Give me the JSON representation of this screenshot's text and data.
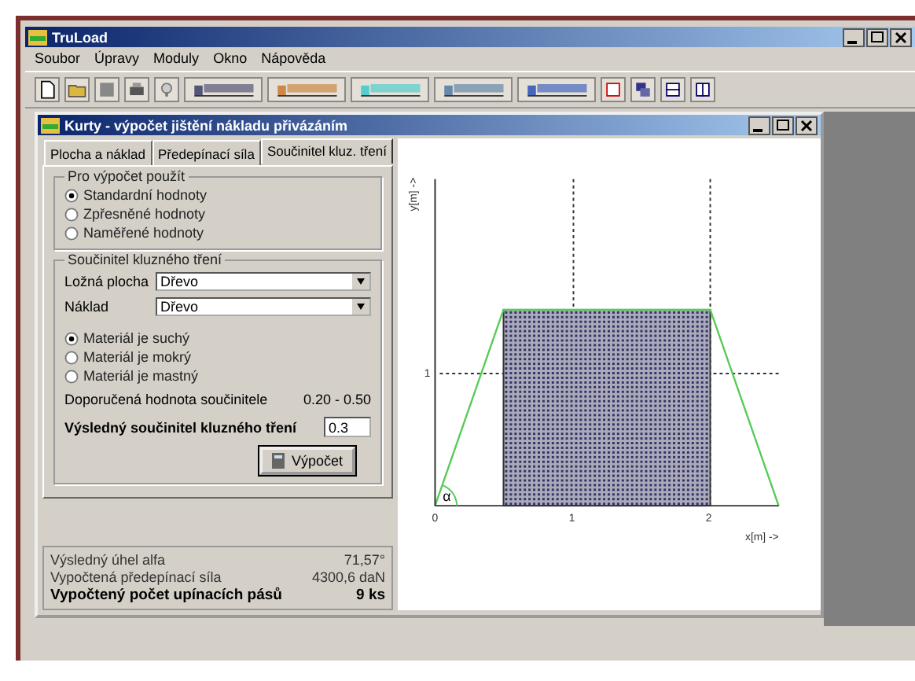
{
  "app_window": {
    "title": "TruLoad"
  },
  "menu": [
    "Soubor",
    "Úpravy",
    "Moduly",
    "Okno",
    "Nápověda"
  ],
  "child_window": {
    "title": "Kurty - výpočet jištění nákladu přivázáním"
  },
  "tabs": [
    {
      "label": "Plocha a náklad",
      "selected": false
    },
    {
      "label": "Předepínací síla",
      "selected": false
    },
    {
      "label": "Součinitel kluz. tření",
      "selected": true
    }
  ],
  "calc_group": {
    "title": "Pro výpočet použít",
    "options": [
      {
        "label": "Standardní hodnoty",
        "selected": true
      },
      {
        "label": "Zpřesněné hodnoty",
        "selected": false
      },
      {
        "label": "Naměřené hodnoty",
        "selected": false
      }
    ]
  },
  "friction_group": {
    "title": "Součinitel kluzného tření",
    "selects": [
      {
        "label": "Ložná plocha",
        "value": "Dřevo"
      },
      {
        "label": "Náklad",
        "value": "Dřevo"
      }
    ],
    "options": [
      {
        "label": "Materiál je suchý",
        "selected": true
      },
      {
        "label": "Materiál je mokrý",
        "selected": false
      },
      {
        "label": "Materiál je mastný",
        "selected": false
      }
    ],
    "recommended_label": "Doporučená hodnota součinitele",
    "recommended_value": "0.20 - 0.50",
    "result_label": "Výsledný součinitel kluzného tření",
    "result_value": "0.3"
  },
  "calc_button": "Výpočet",
  "results": [
    {
      "label": "Výsledný úhel alfa",
      "value": "71,57°",
      "bold": false
    },
    {
      "label": "Vypočtená předepínací síla",
      "value": "4300,6 daN",
      "bold": false
    },
    {
      "label": "Vypočtený počet upínacích pásů",
      "value": "9 ks",
      "bold": true
    }
  ],
  "diagram": {
    "y_axis_label": "y[m] ->",
    "x_axis_label": "x[m] ->",
    "x_ticks": [
      "0",
      "1",
      "2"
    ],
    "y_ticks": [
      "1"
    ],
    "angle_label": "α"
  }
}
